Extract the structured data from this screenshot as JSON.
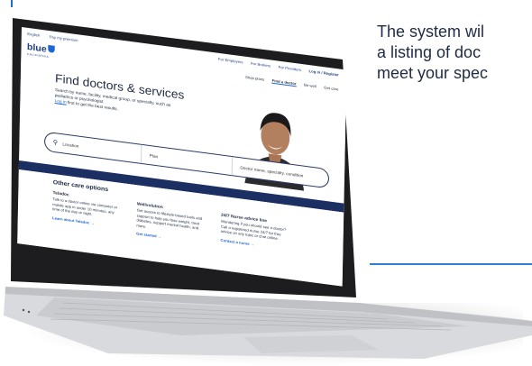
{
  "caption": {
    "lines": [
      "The system wil",
      "a listing of doc",
      "meet your spec"
    ]
  },
  "site": {
    "topbar": {
      "language": "English",
      "pay_premium": "Pay my premium",
      "links": [
        "For Employers",
        "For Brokers",
        "For Providers"
      ],
      "login": "Log in / Register"
    },
    "logo": {
      "text": "blue",
      "sub": "CALIFORNIA"
    },
    "nav": {
      "items": [
        "Shop plans",
        "Find a doctor",
        "Be well",
        "Get care"
      ],
      "active_index": 1
    },
    "hero": {
      "title": "Find doctors & services",
      "description": "Search by name, facility, medical group, or specialty, such as pediatrics or psychologist.",
      "login_link": "Log in",
      "login_suffix": " first to get the best results."
    },
    "search": {
      "location_placeholder": "Location",
      "plan_placeholder": "Plan",
      "query_placeholder": "Doctor name, specialty, condition"
    },
    "other_care": {
      "title": "Other care options",
      "columns": [
        {
          "heading": "Teladoc",
          "text": "Talk to a doctor online via computer or mobile app in under 10 minutes, any time of the day or night.",
          "link": "Learn about Teladoc →"
        },
        {
          "heading": "Wellvolution",
          "text": "Get access to lifestyle-based tools and support to help you lose weight, treat diabetes, support mental health, and more.",
          "link": "Get started →"
        },
        {
          "heading": "24/7 Nurse advice line",
          "text": "Wondering if you should see a doctor? Call a registered nurse 24/7 for free advice on any topic or chat online.",
          "link": "Contact a nurse →"
        }
      ]
    }
  },
  "colors": {
    "brand_blue": "#1d66d6",
    "navy": "#1b2f63",
    "text": "#1f2a44"
  }
}
